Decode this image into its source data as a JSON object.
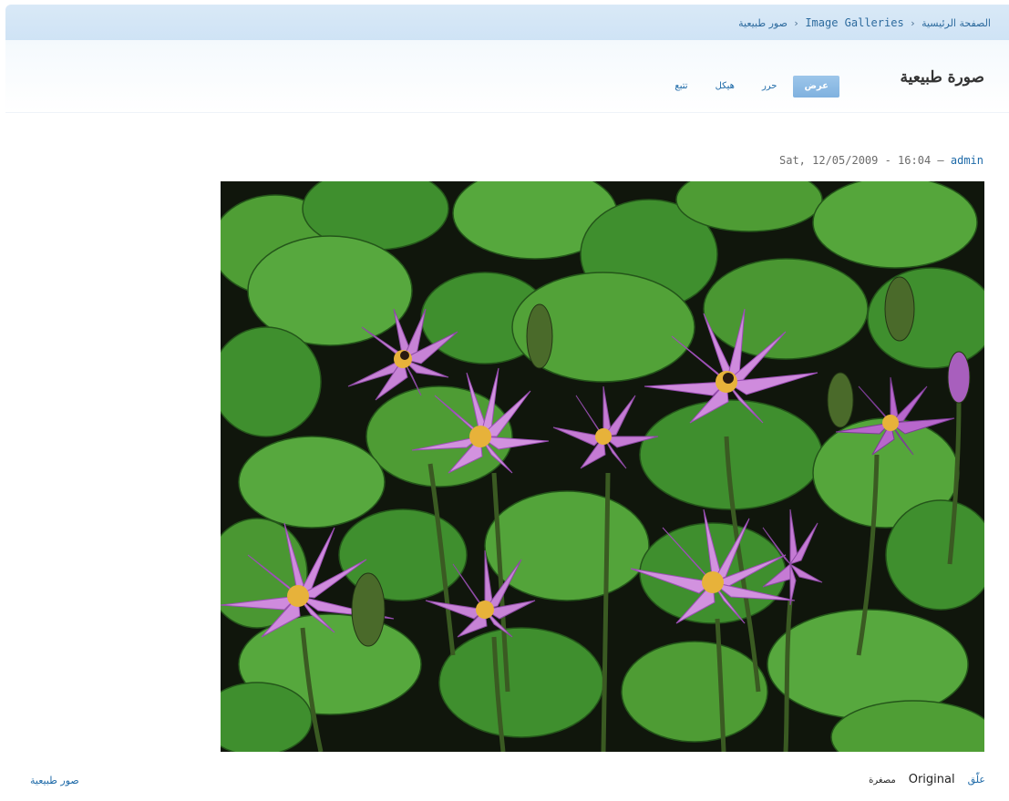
{
  "breadcrumb": {
    "home": "الصفحة الرئيسية",
    "galleries": "Image Galleries",
    "current": "صور طبيعية",
    "separator": "‹"
  },
  "page": {
    "title": "صورة طبيعية"
  },
  "tabs": [
    {
      "label": "عرض",
      "active": true
    },
    {
      "label": "حرر",
      "active": false
    },
    {
      "label": "هيكل",
      "active": false
    },
    {
      "label": "تتبع",
      "active": false
    }
  ],
  "meta": {
    "datetime": "Sat, 12/05/2009 - 16:04",
    "dash": "—",
    "author": "admin"
  },
  "image": {
    "subject": "water lilies photo",
    "colors": {
      "leaf": "#3f8f2e",
      "leaf_light": "#5cab3e",
      "water": "#10160c",
      "petal": "#c783d6",
      "petal_dark": "#9c4fb6",
      "center": "#e7b23a"
    }
  },
  "footer": {
    "enlarge": "علّق",
    "original": "Original",
    "thumbnail": "مصغرة",
    "gallery": "صور طبيعية"
  },
  "colors": {
    "link": "#1e6aa8",
    "tab_active_bg": "#8ebde6",
    "breadcrumb_bg": "#d4e6f6"
  }
}
